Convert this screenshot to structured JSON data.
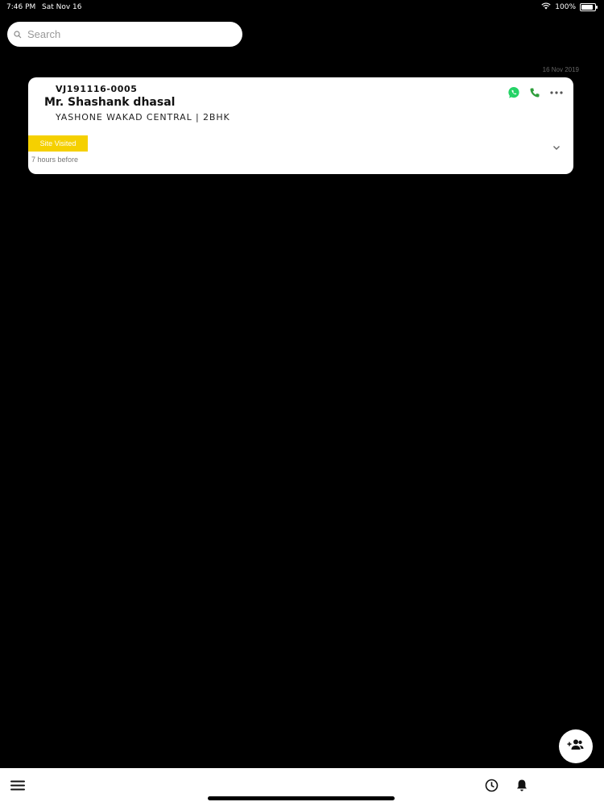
{
  "status_bar": {
    "time": "7:46 PM",
    "date": "Sat Nov 16",
    "battery": "100%",
    "battery_level": 1.0,
    "icons": [
      "wifi-icon",
      "battery-icon"
    ]
  },
  "search": {
    "placeholder": "Search",
    "value": ""
  },
  "list": {
    "date_header": "16 Nov 2019",
    "leads": [
      {
        "id": "VJ191116-0005",
        "name": "Mr. Shashank dhasal",
        "project": "YASHONE WAKAD CENTRAL | 2BHK",
        "status": "Site Visited",
        "time_ago": "7 hours before",
        "actions": [
          "whatsapp-icon",
          "phone-icon",
          "more-icon"
        ]
      }
    ]
  },
  "colors": {
    "background": "#000000",
    "card": "#ffffff",
    "status_badge": "#f5d000",
    "whatsapp": "#25d366",
    "phone": "#2e9e3b"
  },
  "icons": {
    "search": "search-icon",
    "fab": "add-contact-icon",
    "menu": "hamburger-menu-icon",
    "history": "clock-icon",
    "notifications": "bell-icon",
    "expand": "chevron-down-icon"
  }
}
